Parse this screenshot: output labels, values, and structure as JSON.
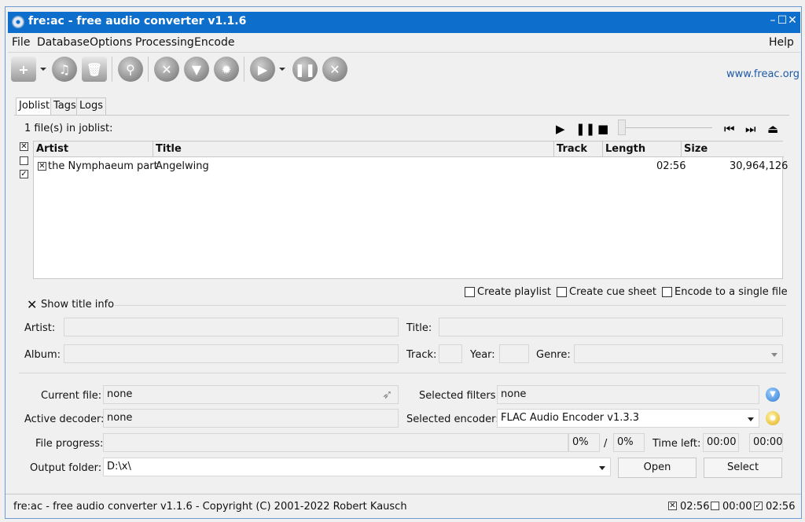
{
  "window": {
    "title": "fre:ac - free audio converter v1.1.6"
  },
  "menu": {
    "file": "File",
    "database": "Database",
    "options": "Options",
    "processing": "Processing",
    "encode": "Encode",
    "help": "Help"
  },
  "toolbar": {
    "website": "www.freac.org"
  },
  "tabs": {
    "joblist": "Joblist",
    "tags": "Tags",
    "logs": "Logs"
  },
  "joblist": {
    "count_text": "1 file(s) in joblist:",
    "columns": {
      "artist": "Artist",
      "title": "Title",
      "track": "Track",
      "length": "Length",
      "size": "Size"
    },
    "rows": [
      {
        "artist": "the Nymphaeum part",
        "title": "Angelwing",
        "track": "",
        "length": "02:56",
        "size": "30,964,126"
      }
    ]
  },
  "options": {
    "create_playlist": "Create playlist",
    "create_cue_sheet": "Create cue sheet",
    "encode_single": "Encode to a single file"
  },
  "titleinfo": {
    "toggle": "Show title info",
    "artist_label": "Artist:",
    "title_label": "Title:",
    "album_label": "Album:",
    "track_label": "Track:",
    "year_label": "Year:",
    "genre_label": "Genre:"
  },
  "status": {
    "current_file_label": "Current file:",
    "current_file": "none",
    "selected_filters_label": "Selected filters:",
    "selected_filters": "none",
    "active_decoder_label": "Active decoder:",
    "active_decoder": "none",
    "selected_encoder_label": "Selected encoder:",
    "selected_encoder": "FLAC Audio Encoder v1.3.3",
    "file_progress_label": "File progress:",
    "file_progress_percent": "0%",
    "slash": "/",
    "total_progress_percent": "0%",
    "time_left_label": "Time left:",
    "time_left_1": "00:00",
    "time_left_2": "00:00",
    "output_folder_label": "Output folder:",
    "output_folder": "D:\\x\\",
    "open_button": "Open",
    "select_button": "Select"
  },
  "statusbar": {
    "text": "fre:ac - free audio converter v1.1.6 - Copyright (C) 2001-2022 Robert Kausch",
    "selected_time": "02:56",
    "unselected_time": "00:00",
    "total_time": "02:56"
  }
}
